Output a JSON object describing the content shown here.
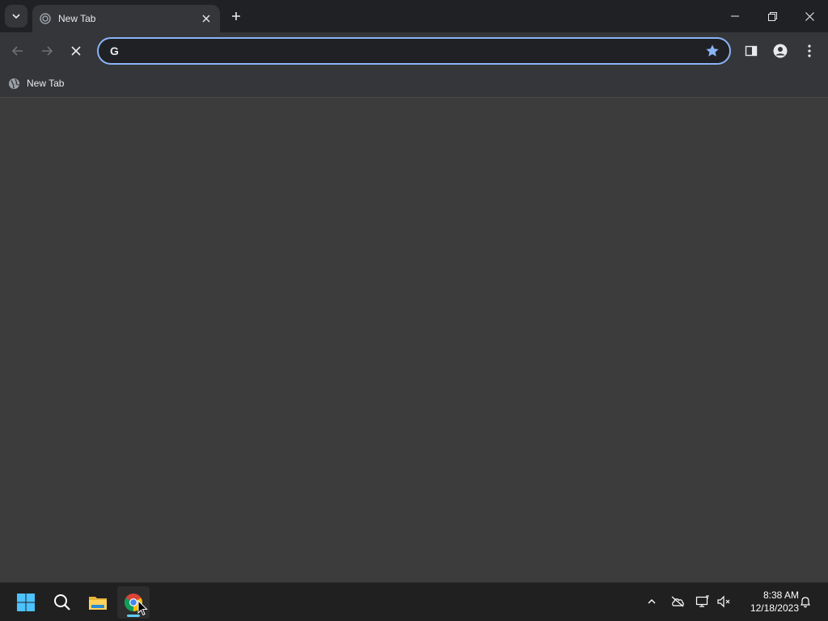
{
  "tab": {
    "title": "New Tab"
  },
  "omnibox": {
    "value": "",
    "placeholder": ""
  },
  "bookmarks": [
    {
      "label": "New Tab"
    }
  ],
  "taskbar": {
    "time": "8:38 AM",
    "date": "12/18/2023",
    "apps": [
      "start",
      "search",
      "file-explorer",
      "chrome"
    ]
  },
  "colors": {
    "accent": "#8ab4f8",
    "star": "#8ab4f8",
    "taskbar_indicator": "#60cdff",
    "page_bg": "#3c3c3c"
  }
}
